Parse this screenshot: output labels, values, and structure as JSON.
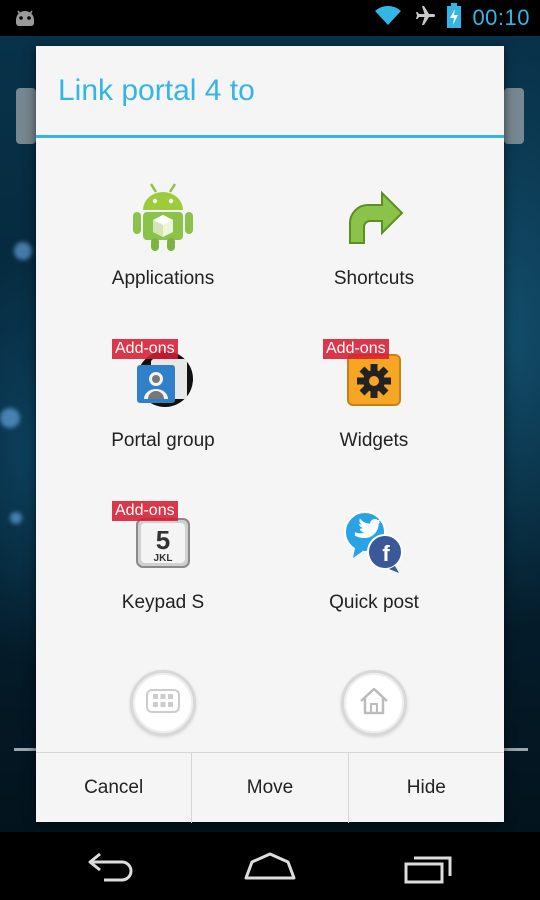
{
  "status_bar": {
    "time": "00:10",
    "icons": [
      "android-notification-icon",
      "wifi-icon",
      "airplane-icon",
      "battery-charging-icon"
    ]
  },
  "dialog": {
    "title": "Link portal 4 to",
    "addons_badge": "Add-ons",
    "items": [
      {
        "label": "Applications",
        "icon": "android-robot-icon",
        "addon": false
      },
      {
        "label": "Shortcuts",
        "icon": "shortcut-arrow-icon",
        "addon": false
      },
      {
        "label": "Portal group",
        "icon": "contacts-icon",
        "addon": true
      },
      {
        "label": "Widgets",
        "icon": "widget-gear-icon",
        "addon": true
      },
      {
        "label": "Keypad S",
        "icon": "keypad-icon",
        "addon": true
      },
      {
        "label": "Quick post",
        "icon": "twitter-facebook-icon",
        "addon": false
      }
    ],
    "round_buttons": [
      "app-drawer-icon",
      "home-icon"
    ],
    "buttons": {
      "cancel": "Cancel",
      "move": "Move",
      "hide": "Hide"
    }
  },
  "nav_bar": {
    "icons": [
      "back-icon",
      "home-icon",
      "recent-apps-icon"
    ]
  },
  "colors": {
    "accent": "#33b5e5",
    "addon_badge": "#d61e32",
    "dialog_bg": "#f5f5f5"
  }
}
